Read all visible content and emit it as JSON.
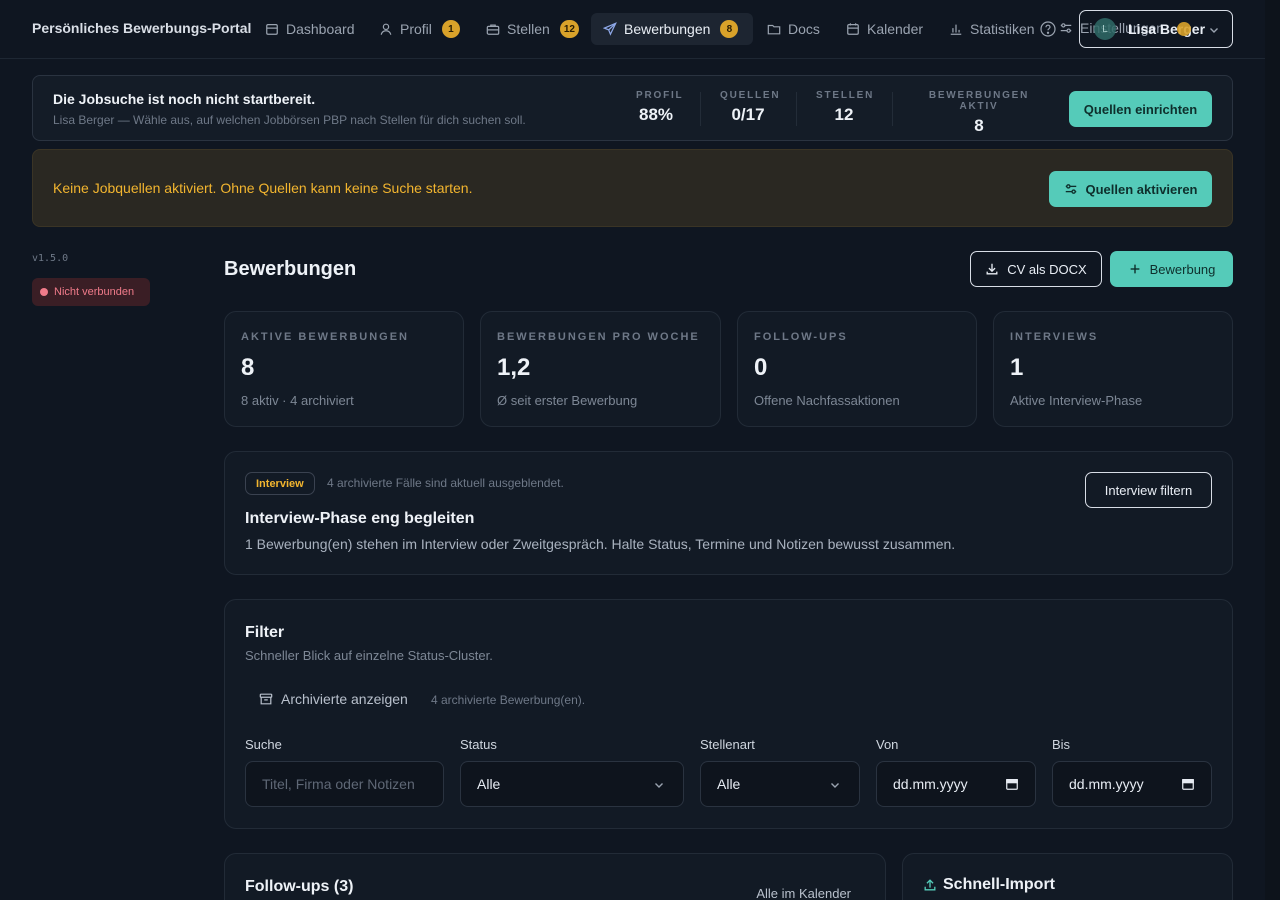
{
  "nav": {
    "brand": "Persönliches Bewerbungs-Portal",
    "items": [
      {
        "label": "Dashboard",
        "icon": "calendar-icon",
        "badge": ""
      },
      {
        "label": "Profil",
        "icon": "user-icon",
        "badge": "1"
      },
      {
        "label": "Stellen",
        "icon": "briefcase-icon",
        "badge": "12"
      },
      {
        "label": "Bewerbungen",
        "icon": "send-icon",
        "badge": "8"
      },
      {
        "label": "Docs",
        "icon": "folder-icon",
        "badge": ""
      },
      {
        "label": "Kalender",
        "icon": "calendar-icon",
        "badge": ""
      },
      {
        "label": "Statistiken",
        "icon": "bar-chart-icon",
        "badge": ""
      }
    ],
    "settings_label": "Einstellungen",
    "user_initial": "L",
    "user_name": "Lisa Berger"
  },
  "readiness": {
    "title": "Die Jobsuche ist noch nicht startbereit.",
    "subtitle": "Lisa Berger — Wähle aus, auf welchen Jobbörsen PBP nach Stellen für dich suchen soll.",
    "stats": [
      {
        "label": "PROFIL",
        "value": "88%"
      },
      {
        "label": "QUELLEN",
        "value": "0/17"
      },
      {
        "label": "STELLEN",
        "value": "12"
      },
      {
        "label": "BEWERBUNGEN AKTIV",
        "value": "8"
      }
    ],
    "button": "Quellen einrichten"
  },
  "warning": {
    "message": "Keine Jobquellen aktiviert. Ohne Quellen kann keine Suche starten.",
    "button": "Quellen aktivieren"
  },
  "sidebar": {
    "version": "v1.5.0",
    "status": "Nicht verbunden"
  },
  "main": {
    "title": "Bewerbungen",
    "cv_button": "CV als DOCX",
    "new_button": "Bewerbung"
  },
  "kpis": [
    {
      "label": "AKTIVE BEWERBUNGEN",
      "value": "8",
      "sub": "8 aktiv · 4 archiviert"
    },
    {
      "label": "BEWERBUNGEN PRO WOCHE",
      "value": "1,2",
      "sub": "Ø seit erster Bewerbung"
    },
    {
      "label": "FOLLOW-UPS",
      "value": "0",
      "sub": "Offene Nachfassaktionen"
    },
    {
      "label": "INTERVIEWS",
      "value": "1",
      "sub": "Aktive Interview-Phase"
    }
  ],
  "interview": {
    "pill": "Interview",
    "note": "4 archivierte Fälle sind aktuell ausgeblendet.",
    "title": "Interview-Phase eng begleiten",
    "desc": "1 Bewerbung(en) stehen im Interview oder Zweitgespräch. Halte Status, Termine und Notizen bewusst zusammen.",
    "button": "Interview filtern"
  },
  "filter": {
    "title": "Filter",
    "subtitle": "Schneller Blick auf einzelne Status-Cluster.",
    "archived_button": "Archivierte anzeigen",
    "archived_note": "4 archivierte Bewerbung(en).",
    "search_label": "Suche",
    "search_placeholder": "Titel, Firma oder Notizen",
    "status_label": "Status",
    "status_value": "Alle",
    "type_label": "Stellenart",
    "type_value": "Alle",
    "from_label": "Von",
    "from_value": "dd.mm.yyyy",
    "to_label": "Bis",
    "to_value": "dd.mm.yyyy"
  },
  "followups": {
    "title": "Follow-ups (3)",
    "link": "Alle im Kalender"
  },
  "import": {
    "title": "Schnell-Import"
  }
}
